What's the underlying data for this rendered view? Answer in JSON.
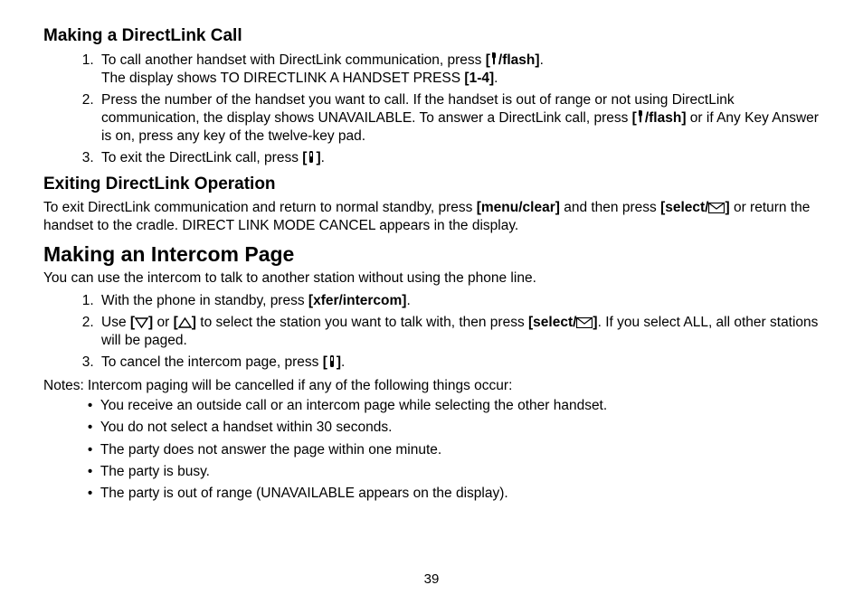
{
  "pageNumber": "39",
  "section1": {
    "heading": "Making a DirectLink Call",
    "items": [
      {
        "parts": [
          {
            "t": "To call another handset with DirectLink communication, press "
          },
          {
            "t": "[",
            "b": true
          },
          {
            "icon": "talk"
          },
          {
            "t": "/flash]",
            "b": true
          },
          {
            "t": "."
          },
          {
            "br": true
          },
          {
            "t": "The display shows TO DIRECTLINK A HANDSET PRESS "
          },
          {
            "t": "[1-4]",
            "b": true
          },
          {
            "t": "."
          }
        ]
      },
      {
        "parts": [
          {
            "t": "Press the number of the handset you want to call. If the handset is out of range or not using DirectLink communication, the display shows UNAVAILABLE. To answer a DirectLink call, press "
          },
          {
            "t": "[",
            "b": true
          },
          {
            "icon": "talk"
          },
          {
            "t": "/flash]",
            "b": true
          },
          {
            "t": " or if Any Key Answer is on, press any key of the twelve-key pad."
          }
        ]
      },
      {
        "parts": [
          {
            "t": "To exit the DirectLink call, press "
          },
          {
            "t": "[",
            "b": true
          },
          {
            "icon": "end"
          },
          {
            "t": "]",
            "b": true
          },
          {
            "t": "."
          }
        ]
      }
    ]
  },
  "section2": {
    "heading": "Exiting DirectLink Operation",
    "paragraph": {
      "parts": [
        {
          "t": "To exit DirectLink communication and return to normal standby, press "
        },
        {
          "t": "[menu/clear]",
          "b": true
        },
        {
          "t": " and then press "
        },
        {
          "t": "[select/",
          "b": true
        },
        {
          "icon": "envelope"
        },
        {
          "t": "]",
          "b": true
        },
        {
          "t": " or return the handset to the cradle. DIRECT LINK MODE CANCEL appears in the display."
        }
      ]
    }
  },
  "section3": {
    "heading": "Making an Intercom Page",
    "intro": "You can use the intercom to talk to another station without using the phone line.",
    "items": [
      {
        "parts": [
          {
            "t": "With the phone in standby, press "
          },
          {
            "t": "[xfer/intercom]",
            "b": true
          },
          {
            "t": "."
          }
        ]
      },
      {
        "parts": [
          {
            "t": "Use "
          },
          {
            "t": "[",
            "b": true
          },
          {
            "icon": "down"
          },
          {
            "t": "]",
            "b": true
          },
          {
            "t": " or "
          },
          {
            "t": "[",
            "b": true
          },
          {
            "icon": "up"
          },
          {
            "t": "]",
            "b": true
          },
          {
            "t": " to select the station you want to talk with, then press "
          },
          {
            "t": "[select/",
            "b": true
          },
          {
            "icon": "envelope"
          },
          {
            "t": "]",
            "b": true
          },
          {
            "t": ". If you select ALL, all other stations will be paged."
          }
        ]
      },
      {
        "parts": [
          {
            "t": "To cancel the intercom page, press "
          },
          {
            "t": "[",
            "b": true
          },
          {
            "icon": "end"
          },
          {
            "t": "]",
            "b": true
          },
          {
            "t": "."
          }
        ]
      }
    ],
    "notesLabel": "Notes:",
    "notesIntro": "Intercom paging will be cancelled if any of the following things occur:",
    "notes": [
      "You receive an outside call or an intercom page while selecting the other handset.",
      "You do not select a handset within 30 seconds.",
      "The party does not answer the page within one minute.",
      "The party is busy.",
      "The party is out of range (UNAVAILABLE appears on the display)."
    ]
  }
}
